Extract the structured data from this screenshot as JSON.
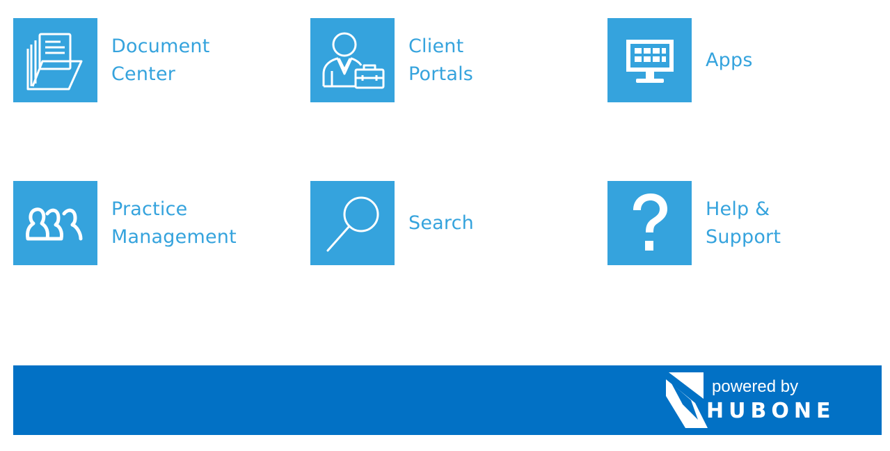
{
  "colors": {
    "tile_bg": "#35a3dd",
    "label": "#35a3dd",
    "footer_bg": "#0271c5"
  },
  "tiles": [
    {
      "label_line1": "Document",
      "label_line2": "Center",
      "icon": "folder-documents-icon"
    },
    {
      "label_line1": "Client",
      "label_line2": "Portals",
      "icon": "client-briefcase-icon"
    },
    {
      "label_line1": "Apps",
      "label_line2": "",
      "icon": "monitor-apps-icon"
    },
    {
      "label_line1": "Practice",
      "label_line2": "Management",
      "icon": "people-group-icon"
    },
    {
      "label_line1": "Search",
      "label_line2": "",
      "icon": "magnifier-icon"
    },
    {
      "label_line1": "Help &",
      "label_line2": "Support",
      "icon": "question-mark-icon"
    }
  ],
  "footer": {
    "powered_by": "powered by",
    "brand_name": "HUBONE"
  }
}
